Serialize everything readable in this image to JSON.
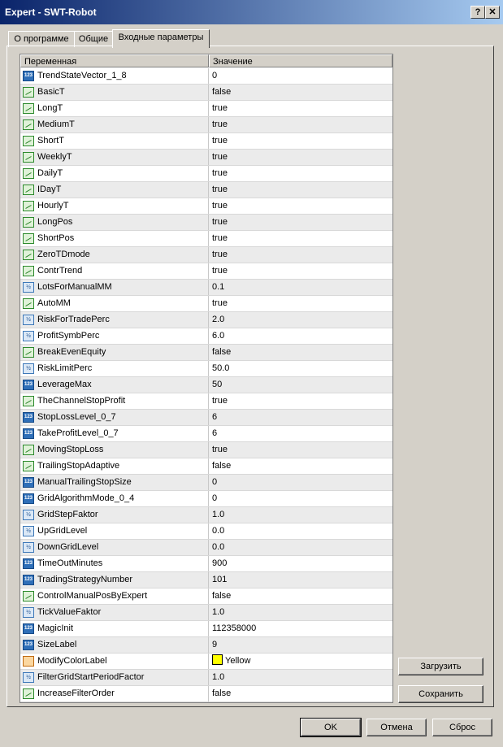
{
  "window": {
    "title": "Expert - SWT-Robot",
    "help_label": "?",
    "close_label": "✕"
  },
  "tabs": [
    {
      "label": "О программе"
    },
    {
      "label": "Общие"
    },
    {
      "label": "Входные параметры"
    }
  ],
  "table": {
    "headers": [
      "Переменная",
      "Значение"
    ],
    "rows": [
      {
        "name": "TrendStateVector_1_8",
        "value": "0",
        "icon": "int-icon"
      },
      {
        "name": "BasicT",
        "value": "false",
        "icon": "bool-icon"
      },
      {
        "name": "LongT",
        "value": "true",
        "icon": "bool-icon"
      },
      {
        "name": "MediumT",
        "value": "true",
        "icon": "bool-icon"
      },
      {
        "name": "ShortT",
        "value": "true",
        "icon": "bool-icon"
      },
      {
        "name": "WeeklyT",
        "value": "true",
        "icon": "bool-icon"
      },
      {
        "name": "DailyT",
        "value": "true",
        "icon": "bool-icon"
      },
      {
        "name": "IDayT",
        "value": "true",
        "icon": "bool-icon"
      },
      {
        "name": "HourlyT",
        "value": "true",
        "icon": "bool-icon"
      },
      {
        "name": "LongPos",
        "value": "true",
        "icon": "bool-icon"
      },
      {
        "name": "ShortPos",
        "value": "true",
        "icon": "bool-icon"
      },
      {
        "name": "ZeroTDmode",
        "value": "true",
        "icon": "bool-icon"
      },
      {
        "name": "ContrTrend",
        "value": "true",
        "icon": "bool-icon"
      },
      {
        "name": "LotsForManualMM",
        "value": "0.1",
        "icon": "double-icon"
      },
      {
        "name": "AutoMM",
        "value": "true",
        "icon": "bool-icon"
      },
      {
        "name": "RiskForTradePerc",
        "value": "2.0",
        "icon": "double-icon"
      },
      {
        "name": "ProfitSymbPerc",
        "value": "6.0",
        "icon": "double-icon"
      },
      {
        "name": "BreakEvenEquity",
        "value": "false",
        "icon": "bool-icon"
      },
      {
        "name": "RiskLimitPerc",
        "value": "50.0",
        "icon": "double-icon"
      },
      {
        "name": "LeverageMax",
        "value": "50",
        "icon": "int-icon"
      },
      {
        "name": "TheChannelStopProfit",
        "value": "true",
        "icon": "bool-icon"
      },
      {
        "name": "StopLossLevel_0_7",
        "value": "6",
        "icon": "int-icon"
      },
      {
        "name": "TakeProfitLevel_0_7",
        "value": "6",
        "icon": "int-icon"
      },
      {
        "name": "MovingStopLoss",
        "value": "true",
        "icon": "bool-icon"
      },
      {
        "name": "TrailingStopAdaptive",
        "value": "false",
        "icon": "bool-icon"
      },
      {
        "name": "ManualTrailingStopSize",
        "value": "0",
        "icon": "int-icon"
      },
      {
        "name": "GridAlgorithmMode_0_4",
        "value": "0",
        "icon": "int-icon"
      },
      {
        "name": "GridStepFaktor",
        "value": "1.0",
        "icon": "double-icon"
      },
      {
        "name": "UpGridLevel",
        "value": "0.0",
        "icon": "double-icon"
      },
      {
        "name": "DownGridLevel",
        "value": "0.0",
        "icon": "double-icon"
      },
      {
        "name": "TimeOutMinutes",
        "value": "900",
        "icon": "int-icon"
      },
      {
        "name": "TradingStrategyNumber",
        "value": "101",
        "icon": "int-icon"
      },
      {
        "name": "ControlManualPosByExpert",
        "value": "false",
        "icon": "bool-icon"
      },
      {
        "name": "TickValueFaktor",
        "value": "1.0",
        "icon": "double-icon"
      },
      {
        "name": "MagicInit",
        "value": "112358000",
        "icon": "int-icon"
      },
      {
        "name": "SizeLabel",
        "value": "9",
        "icon": "int-icon"
      },
      {
        "name": "ModifyColorLabel",
        "value": "Yellow",
        "icon": "color-icon",
        "swatch": "#ffff00"
      },
      {
        "name": "FilterGridStartPeriodFactor",
        "value": "1.0",
        "icon": "double-icon"
      },
      {
        "name": "IncreaseFilterOrder",
        "value": "false",
        "icon": "bool-icon"
      }
    ]
  },
  "side_buttons": {
    "load_label": "Загрузить",
    "save_label": "Сохранить"
  },
  "footer": {
    "ok_label": "OK",
    "cancel_label": "Отмена",
    "reset_label": "Сброс"
  },
  "icons": {
    "int_text": "123",
    "double_text": "½"
  }
}
